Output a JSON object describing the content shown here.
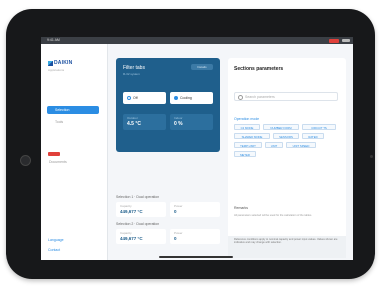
{
  "status": {
    "time": "9:41 AM"
  },
  "sidebar": {
    "brand": "DAIKIN",
    "brand_sub": "Applications",
    "items": [
      {
        "label": "Selection"
      },
      {
        "label": "Tools"
      }
    ],
    "badge_text": "Documents",
    "bottom": [
      {
        "label": "Language"
      },
      {
        "label": "Contact"
      }
    ]
  },
  "card": {
    "title": "Filter tabs",
    "sub": "R-32 system",
    "chip": "Details",
    "options": [
      {
        "label": "Off"
      },
      {
        "label": "Cooling"
      }
    ],
    "metrics": [
      {
        "label": "Outdoor",
        "value": "4.5 °C"
      },
      {
        "label": "Indoor",
        "value": "0 %"
      }
    ]
  },
  "history": [
    {
      "title": "Selection 1 · Dual operation",
      "label": "Capacity",
      "value": "449,677 °C",
      "label2": "Power",
      "value2": "0"
    },
    {
      "title": "Selection 2 · Dual operation",
      "label": "Capacity",
      "value": "449,677 °C",
      "label2": "Power",
      "value2": "0"
    }
  ],
  "panel": {
    "title": "Sections parameters",
    "search_placeholder": "Search parameters",
    "section_label": "Operation mode",
    "tags": [
      "C2 MODE",
      "NUMBER FORM",
      "CIRCUIT TS",
      "SHARED MODE",
      "SENSORS",
      "RATED",
      "TEMP LIMIT",
      "UNIT",
      "UNIT SPEED",
      "METER"
    ],
    "note_title": "Remarks",
    "note_text": "All parameters selected will be used for the calculation of the tables.",
    "footer_text": "Reference conditions apply to nominal capacity and power input values. Values shown are indicative and may change with selection."
  }
}
